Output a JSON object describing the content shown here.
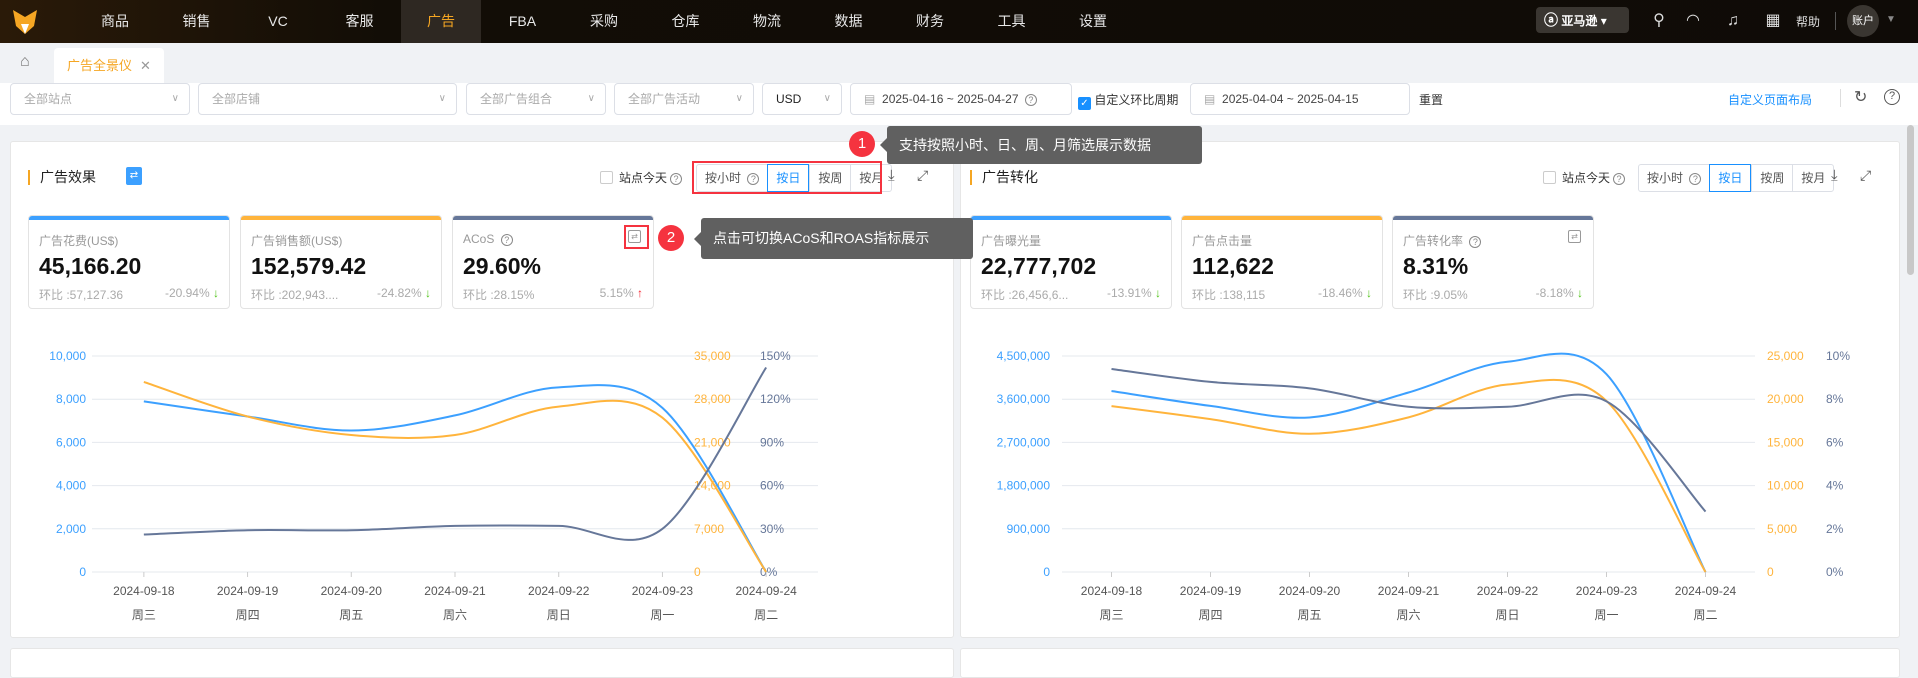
{
  "nav": {
    "items": [
      "商品",
      "销售",
      "VC",
      "客服",
      "广告",
      "FBA",
      "采购",
      "仓库",
      "物流",
      "数据",
      "财务",
      "工具",
      "设置"
    ],
    "active": "广告",
    "marketplace": "亚马逊",
    "help": "帮助",
    "account": "账户"
  },
  "tabs": {
    "active_tab": "广告全景仪"
  },
  "filters": {
    "site": "全部站点",
    "shop": "全部店铺",
    "ad_group": "全部广告组合",
    "campaign": "全部广告活动",
    "currency": "USD",
    "date_start": "2025-04-16",
    "date_end": "2025-04-27",
    "date_sep": "~",
    "custom_compare_label": "自定义环比周期",
    "custom_compare_checked": true,
    "compare_start": "2025-04-04",
    "compare_end": "2025-04-15",
    "reset": "重置",
    "custom_layout": "自定义页面布局"
  },
  "granularity": [
    "按小时",
    "按日",
    "按周",
    "按月"
  ],
  "site_today": "站点今天",
  "annotations": [
    {
      "num": "1",
      "text": "支持按照小时、日、周、月筛选展示数据"
    },
    {
      "num": "2",
      "text": "点击可切换ACoS和ROAS指标展示"
    }
  ],
  "colors": {
    "blue": "#3ca0ff",
    "orange": "#ffb43c",
    "gray": "#667799",
    "accent": "#f5a623"
  },
  "left_panel": {
    "title": "广告效果",
    "cards": [
      {
        "label": "广告花费(US$)",
        "value": "45,166.20",
        "compare": "环比 :57,127.36",
        "change": "-20.94%",
        "dir": "down"
      },
      {
        "label": "广告销售额(US$)",
        "value": "152,579.42",
        "compare": "环比 :202,943....",
        "change": "-24.82%",
        "dir": "down"
      },
      {
        "label": "ACoS",
        "value": "29.60%",
        "compare": "环比 :28.15%",
        "change": "5.15%",
        "dir": "up"
      }
    ]
  },
  "right_panel": {
    "title": "广告转化",
    "cards": [
      {
        "label": "广告曝光量",
        "value": "22,777,702",
        "compare": "环比 :26,456,6...",
        "change": "-13.91%",
        "dir": "down"
      },
      {
        "label": "广告点击量",
        "value": "112,622",
        "compare": "环比 :138,115",
        "change": "-18.46%",
        "dir": "down"
      },
      {
        "label": "广告转化率",
        "value": "8.31%",
        "compare": "环比 :9.05%",
        "change": "-8.18%",
        "dir": "down"
      }
    ]
  },
  "chart_data": [
    {
      "type": "line",
      "x": [
        "2024-09-18",
        "2024-09-19",
        "2024-09-20",
        "2024-09-21",
        "2024-09-22",
        "2024-09-23",
        "2024-09-24"
      ],
      "x2": [
        "周三",
        "周四",
        "周五",
        "周六",
        "周日",
        "周一",
        "周二"
      ],
      "axes": [
        {
          "ticks": [
            "0",
            "2,000",
            "4,000",
            "6,000",
            "8,000",
            "10,000"
          ],
          "range": [
            0,
            10000
          ]
        },
        {
          "ticks": [
            "0",
            "7,000",
            "14,000",
            "21,000",
            "28,000",
            "35,000"
          ],
          "range": [
            0,
            35000
          ]
        },
        {
          "ticks": [
            "0%",
            "30%",
            "60%",
            "90%",
            "120%",
            "150%"
          ],
          "range": [
            0,
            150
          ]
        }
      ],
      "series": [
        {
          "name": "广告花费",
          "axis": 0,
          "color": "#3ca0ff",
          "values": [
            7900,
            7200,
            6550,
            7250,
            8550,
            7600,
            0
          ]
        },
        {
          "name": "广告销售额",
          "axis": 1,
          "color": "#ffb43c",
          "values": [
            30800,
            25200,
            22200,
            22200,
            26800,
            25000,
            0
          ]
        },
        {
          "name": "ACoS",
          "axis": 2,
          "color": "#667799",
          "values": [
            26,
            29,
            29,
            32,
            32,
            30,
            142
          ]
        }
      ]
    },
    {
      "type": "line",
      "x": [
        "2024-09-18",
        "2024-09-19",
        "2024-09-20",
        "2024-09-21",
        "2024-09-22",
        "2024-09-23",
        "2024-09-24"
      ],
      "x2": [
        "周三",
        "周四",
        "周五",
        "周六",
        "周日",
        "周一",
        "周二"
      ],
      "axes": [
        {
          "ticks": [
            "0",
            "900,000",
            "1,800,000",
            "2,700,000",
            "3,600,000",
            "4,500,000"
          ],
          "range": [
            0,
            4500000
          ]
        },
        {
          "ticks": [
            "0",
            "5,000",
            "10,000",
            "15,000",
            "20,000",
            "25,000"
          ],
          "range": [
            0,
            25000
          ]
        },
        {
          "ticks": [
            "0%",
            "2%",
            "4%",
            "6%",
            "8%",
            "10%"
          ],
          "range": [
            0,
            10
          ]
        }
      ],
      "series": [
        {
          "name": "广告曝光量",
          "axis": 0,
          "color": "#3ca0ff",
          "values": [
            3770000,
            3460000,
            3220000,
            3740000,
            4380000,
            4120000,
            0
          ]
        },
        {
          "name": "广告点击量",
          "axis": 1,
          "color": "#ffb43c",
          "values": [
            19200,
            17700,
            16000,
            17900,
            21700,
            19800,
            0
          ]
        },
        {
          "name": "广告转化率",
          "axis": 2,
          "color": "#667799",
          "values": [
            9.4,
            8.8,
            8.5,
            7.65,
            7.65,
            7.9,
            2.8
          ]
        }
      ]
    }
  ]
}
